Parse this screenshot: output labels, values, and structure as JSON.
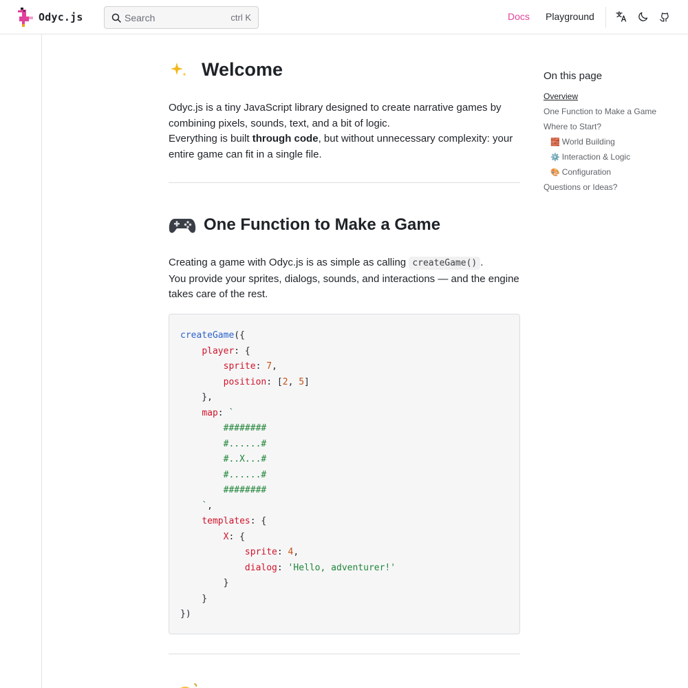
{
  "header": {
    "logo_text": "Odyc.js",
    "search": {
      "placeholder": "Search",
      "shortcut": "ctrl K"
    },
    "nav": {
      "docs": "Docs",
      "playground": "Playground"
    },
    "icons": [
      "translate-icon",
      "moon-icon",
      "github-icon"
    ],
    "accent_color": "#e1429b"
  },
  "main": {
    "welcome_title": "Welcome",
    "intro_line1": "Odyc.js is a tiny JavaScript library designed to create narrative games by combining pixels, sounds, text, and a bit of logic.",
    "intro_line2_pre": "Everything is built ",
    "intro_line2_bold": "through code",
    "intro_line2_post": ", but without unnecessary complexity: your entire game can fit in a single file.",
    "section_title": "One Function to Make a Game",
    "section_line1_pre": "Creating a game with Odyc.js is as simple as calling ",
    "section_line1_code": "createGame()",
    "section_line1_post": ".",
    "section_line2": "You provide your sprites, dialogs, sounds, and interactions — and the engine takes care of the rest."
  },
  "code": {
    "fn": "createGame",
    "player_key": "player",
    "sprite_key": "sprite",
    "sprite_val": "7",
    "position_key": "position",
    "pos_x": "2",
    "pos_y": "5",
    "map_key": "map",
    "map_rows": [
      "########",
      "#......#",
      "#..X...#",
      "#......#",
      "########"
    ],
    "templates_key": "templates",
    "x_key": "X",
    "x_sprite_val": "4",
    "dialog_key": "dialog",
    "dialog_val": "'Hello, adventurer!'"
  },
  "toc": {
    "title": "On this page",
    "items": [
      {
        "label": "Overview",
        "emoji": ""
      },
      {
        "label": "One Function to Make a Game",
        "emoji": ""
      },
      {
        "label": "Where to Start?",
        "emoji": ""
      },
      {
        "label": "World Building",
        "emoji": "🧱"
      },
      {
        "label": "Interaction & Logic",
        "emoji": "⚙️"
      },
      {
        "label": "Configuration",
        "emoji": "🎨"
      },
      {
        "label": "Questions or Ideas?",
        "emoji": ""
      }
    ]
  }
}
